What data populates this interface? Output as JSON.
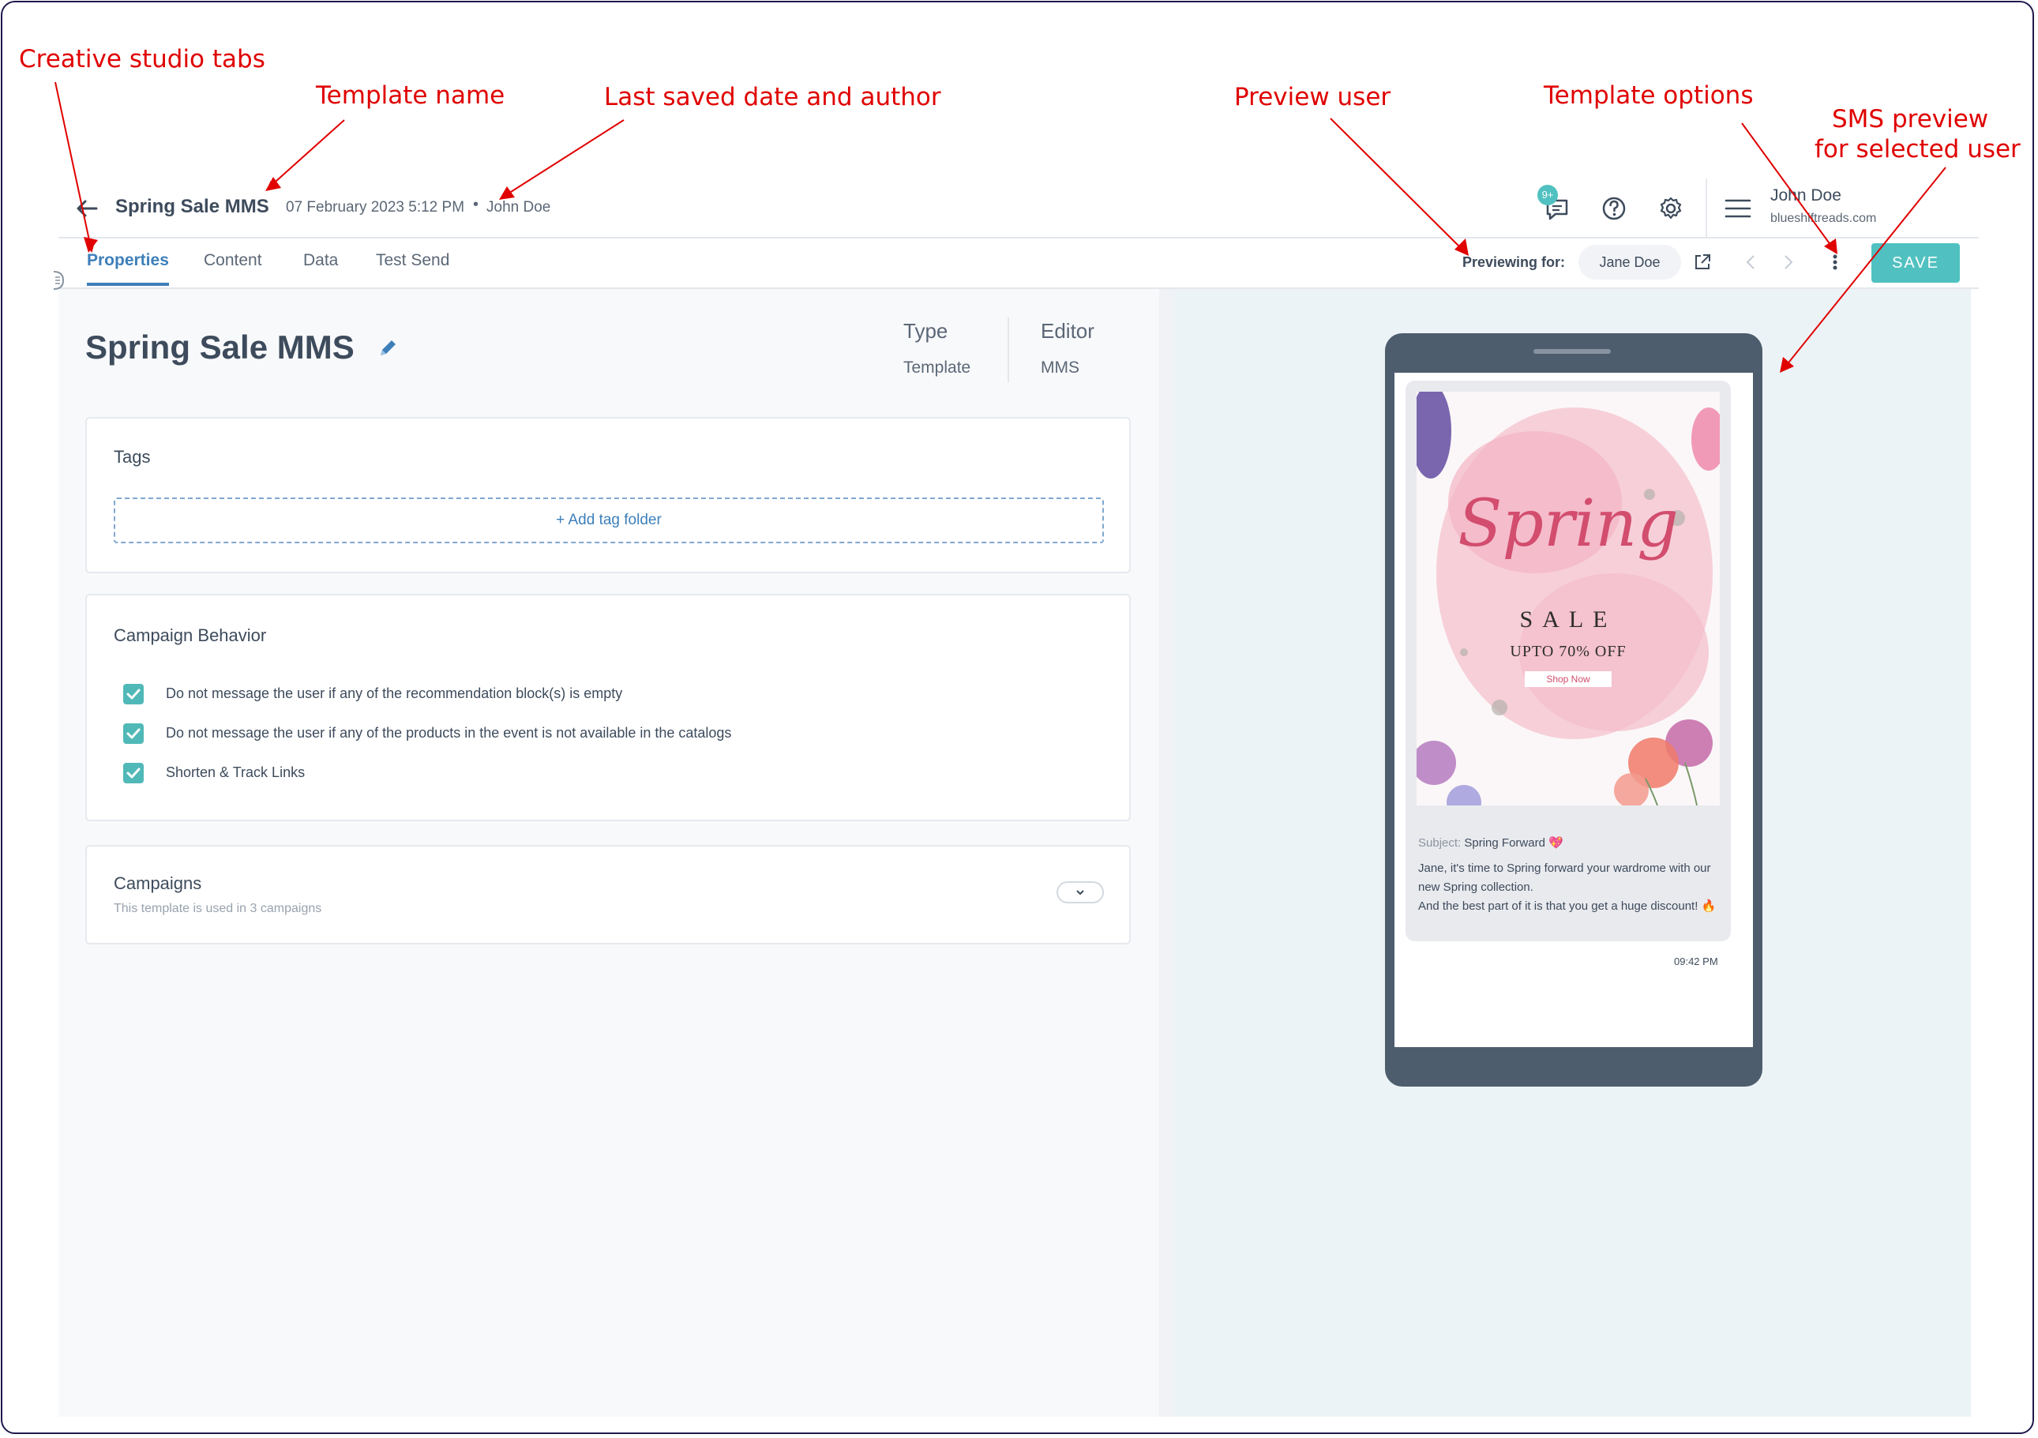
{
  "annotations": {
    "tabs": "Creative studio tabs",
    "template_name": "Template name",
    "last_saved": "Last saved date and author",
    "preview_user": "Preview user",
    "template_options": "Template options",
    "sms_preview_line1": "SMS preview",
    "sms_preview_line2": "for selected user"
  },
  "header": {
    "template_name": "Spring Sale MMS",
    "saved_date": "07 February 2023 5:12 PM",
    "separator": "•",
    "author": "John Doe",
    "notification_count": "9+",
    "user_name": "John Doe",
    "user_org": "blueshiftreads.com",
    "icons": [
      "back-arrow-icon",
      "chat-icon",
      "help-icon",
      "gear-icon",
      "hamburger-icon"
    ]
  },
  "tabs": [
    {
      "label": "Properties",
      "active": true
    },
    {
      "label": "Content",
      "active": false
    },
    {
      "label": "Data",
      "active": false
    },
    {
      "label": "Test Send",
      "active": false
    }
  ],
  "preview": {
    "label": "Previewing for:",
    "user": "Jane Doe",
    "save_label": "SAVE"
  },
  "properties": {
    "title": "Spring Sale MMS",
    "type_label": "Type",
    "type_value": "Template",
    "editor_label": "Editor",
    "editor_value": "MMS"
  },
  "tags_card": {
    "title": "Tags",
    "add_label": "+ Add tag folder"
  },
  "behavior_card": {
    "title": "Campaign Behavior",
    "options": [
      {
        "label": "Do not message the user if any of the recommendation block(s) is empty",
        "checked": true
      },
      {
        "label": "Do not message the user if any of the products in the event is not available in the catalogs",
        "checked": true
      },
      {
        "label": "Shorten & Track Links",
        "checked": true
      }
    ]
  },
  "campaigns_card": {
    "title": "Campaigns",
    "subtitle": "This template is used in 3 campaigns"
  },
  "sms_preview": {
    "image": {
      "headline": "Spring",
      "sale": "SALE",
      "offer": "UPTO 70% OFF",
      "cta": "Shop Now"
    },
    "subject_label": "Subject:",
    "subject_value": "Spring Forward 💖",
    "message_line1": "Jane, it's time to Spring forward your wardrome with our new Spring collection.",
    "message_line2": "And the best part of it is that you get a huge discount! 🔥",
    "time": "09:42 PM"
  },
  "colors": {
    "accent": "#50c1c0",
    "link": "#3d7fb9",
    "annotation": "#e00000",
    "phone": "#4d5d6d"
  }
}
